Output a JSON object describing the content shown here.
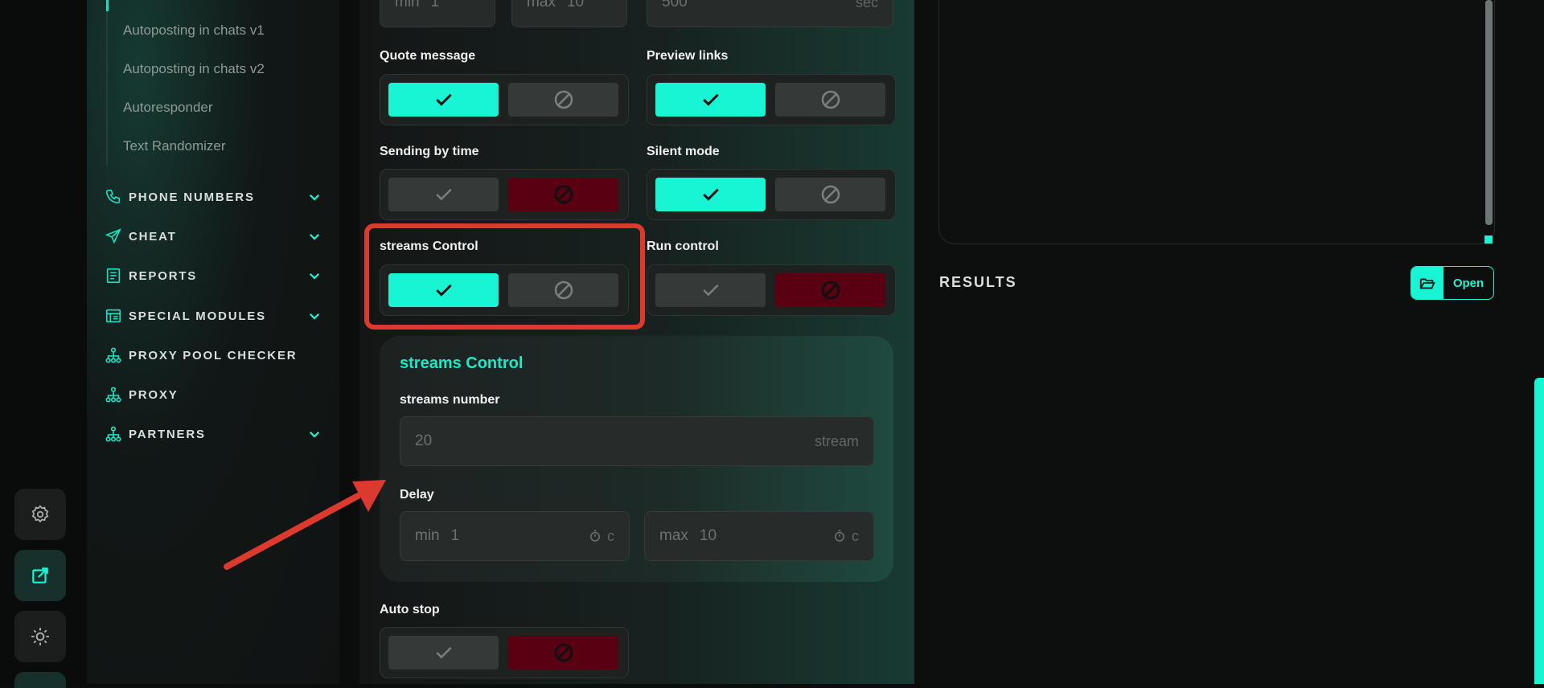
{
  "sidebar": {
    "sub_items": [
      "Autoposting in chats v1",
      "Autoposting in chats v2",
      "Autoresponder",
      "Text Randomizer"
    ],
    "nav": [
      {
        "label": "PHONE NUMBERS",
        "icon": "phone-icon",
        "expandable": true
      },
      {
        "label": "CHEAT",
        "icon": "send-icon",
        "expandable": true
      },
      {
        "label": "REPORTS",
        "icon": "report-icon",
        "expandable": true
      },
      {
        "label": "SPECIAL MODULES",
        "icon": "modules-icon",
        "expandable": true
      },
      {
        "label": "PROXY POOL CHECKER",
        "icon": "network-icon",
        "expandable": false
      },
      {
        "label": "PROXY",
        "icon": "network-icon",
        "expandable": false
      },
      {
        "label": "PARTNERS",
        "icon": "network-icon",
        "expandable": true
      }
    ]
  },
  "top_fields": {
    "min_ph": "min",
    "min_val": "1",
    "max_ph": "max",
    "max_val": "10",
    "interval_val": "500",
    "interval_suffix": "sec"
  },
  "toggles": {
    "quote": {
      "label": "Quote message",
      "state": "on"
    },
    "preview": {
      "label": "Preview links",
      "state": "on"
    },
    "sending_time": {
      "label": "Sending by time",
      "state": "off"
    },
    "silent": {
      "label": "Silent mode",
      "state": "on"
    },
    "streams": {
      "label": "streams Control",
      "state": "on"
    },
    "run": {
      "label": "Run control",
      "state": "off"
    },
    "auto_stop": {
      "label": "Auto stop",
      "state": "off"
    }
  },
  "streams_card": {
    "title": "streams Control",
    "number_label": "streams number",
    "number_value": "20",
    "number_suffix": "stream",
    "delay_label": "Delay",
    "delay_min_ph": "min",
    "delay_min_val": "1",
    "delay_max_ph": "max",
    "delay_max_val": "10",
    "delay_suffix": "c"
  },
  "results": {
    "title": "RESULTS",
    "open_label": "Open"
  },
  "colors": {
    "accent": "#18f5d5",
    "danger": "#590012",
    "highlight": "#dc3a2f"
  }
}
